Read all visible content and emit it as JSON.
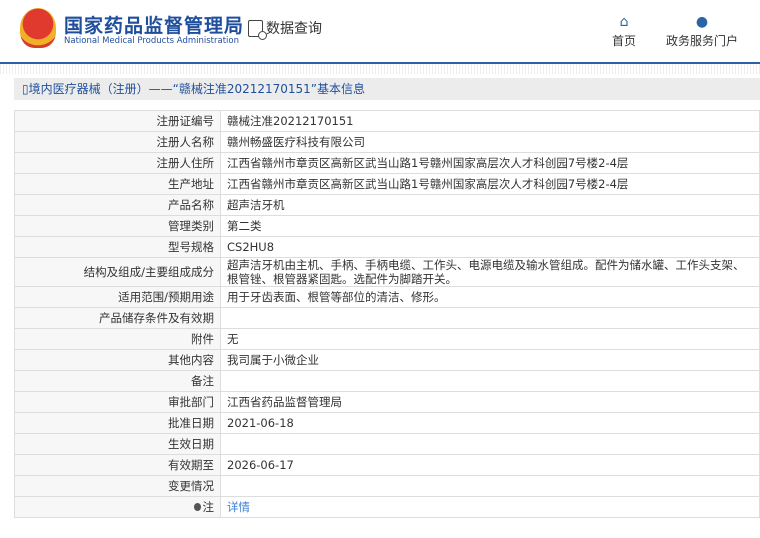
{
  "header": {
    "logo_cn": "国家药品监督管理局",
    "logo_en": "National Medical Products Administration",
    "data_query": "数据查询",
    "nav": [
      {
        "label": "首页",
        "icon": "home-icon"
      },
      {
        "label": "政务服务门户",
        "icon": "user-icon"
      }
    ]
  },
  "panel_title": "境内医疗器械（注册）——“赣械注准20212170151”基本信息",
  "rows": [
    {
      "k": "注册证编号",
      "v": "赣械注准20212170151"
    },
    {
      "k": "注册人名称",
      "v": "赣州畅盛医疗科技有限公司"
    },
    {
      "k": "注册人住所",
      "v": "江西省赣州市章贡区高新区武当山路1号赣州国家高层次人才科创园7号楼2-4层"
    },
    {
      "k": "生产地址",
      "v": "江西省赣州市章贡区高新区武当山路1号赣州国家高层次人才科创园7号楼2-4层"
    },
    {
      "k": "产品名称",
      "v": "超声洁牙机"
    },
    {
      "k": "管理类别",
      "v": "第二类"
    },
    {
      "k": "型号规格",
      "v": "CS2HU8"
    },
    {
      "k": "结构及组成/主要组成成分",
      "v": "超声洁牙机由主机、手柄、手柄电缆、工作头、电源电缆及输水管组成。配件为储水罐、工作头支架、根管锉、根管器紧固匙。选配件为脚踏开关。"
    },
    {
      "k": "适用范围/预期用途",
      "v": "用于牙齿表面、根管等部位的清洁、修形。"
    },
    {
      "k": "产品储存条件及有效期",
      "v": ""
    },
    {
      "k": "附件",
      "v": "无"
    },
    {
      "k": "其他内容",
      "v": "我司属于小微企业"
    },
    {
      "k": "备注",
      "v": ""
    },
    {
      "k": "审批部门",
      "v": "江西省药品监督管理局"
    },
    {
      "k": "批准日期",
      "v": "2021-06-18"
    },
    {
      "k": "生效日期",
      "v": ""
    },
    {
      "k": "有效期至",
      "v": "2026-06-17"
    },
    {
      "k": "变更情况",
      "v": ""
    }
  ],
  "note": {
    "k": "注",
    "v": "详情"
  }
}
